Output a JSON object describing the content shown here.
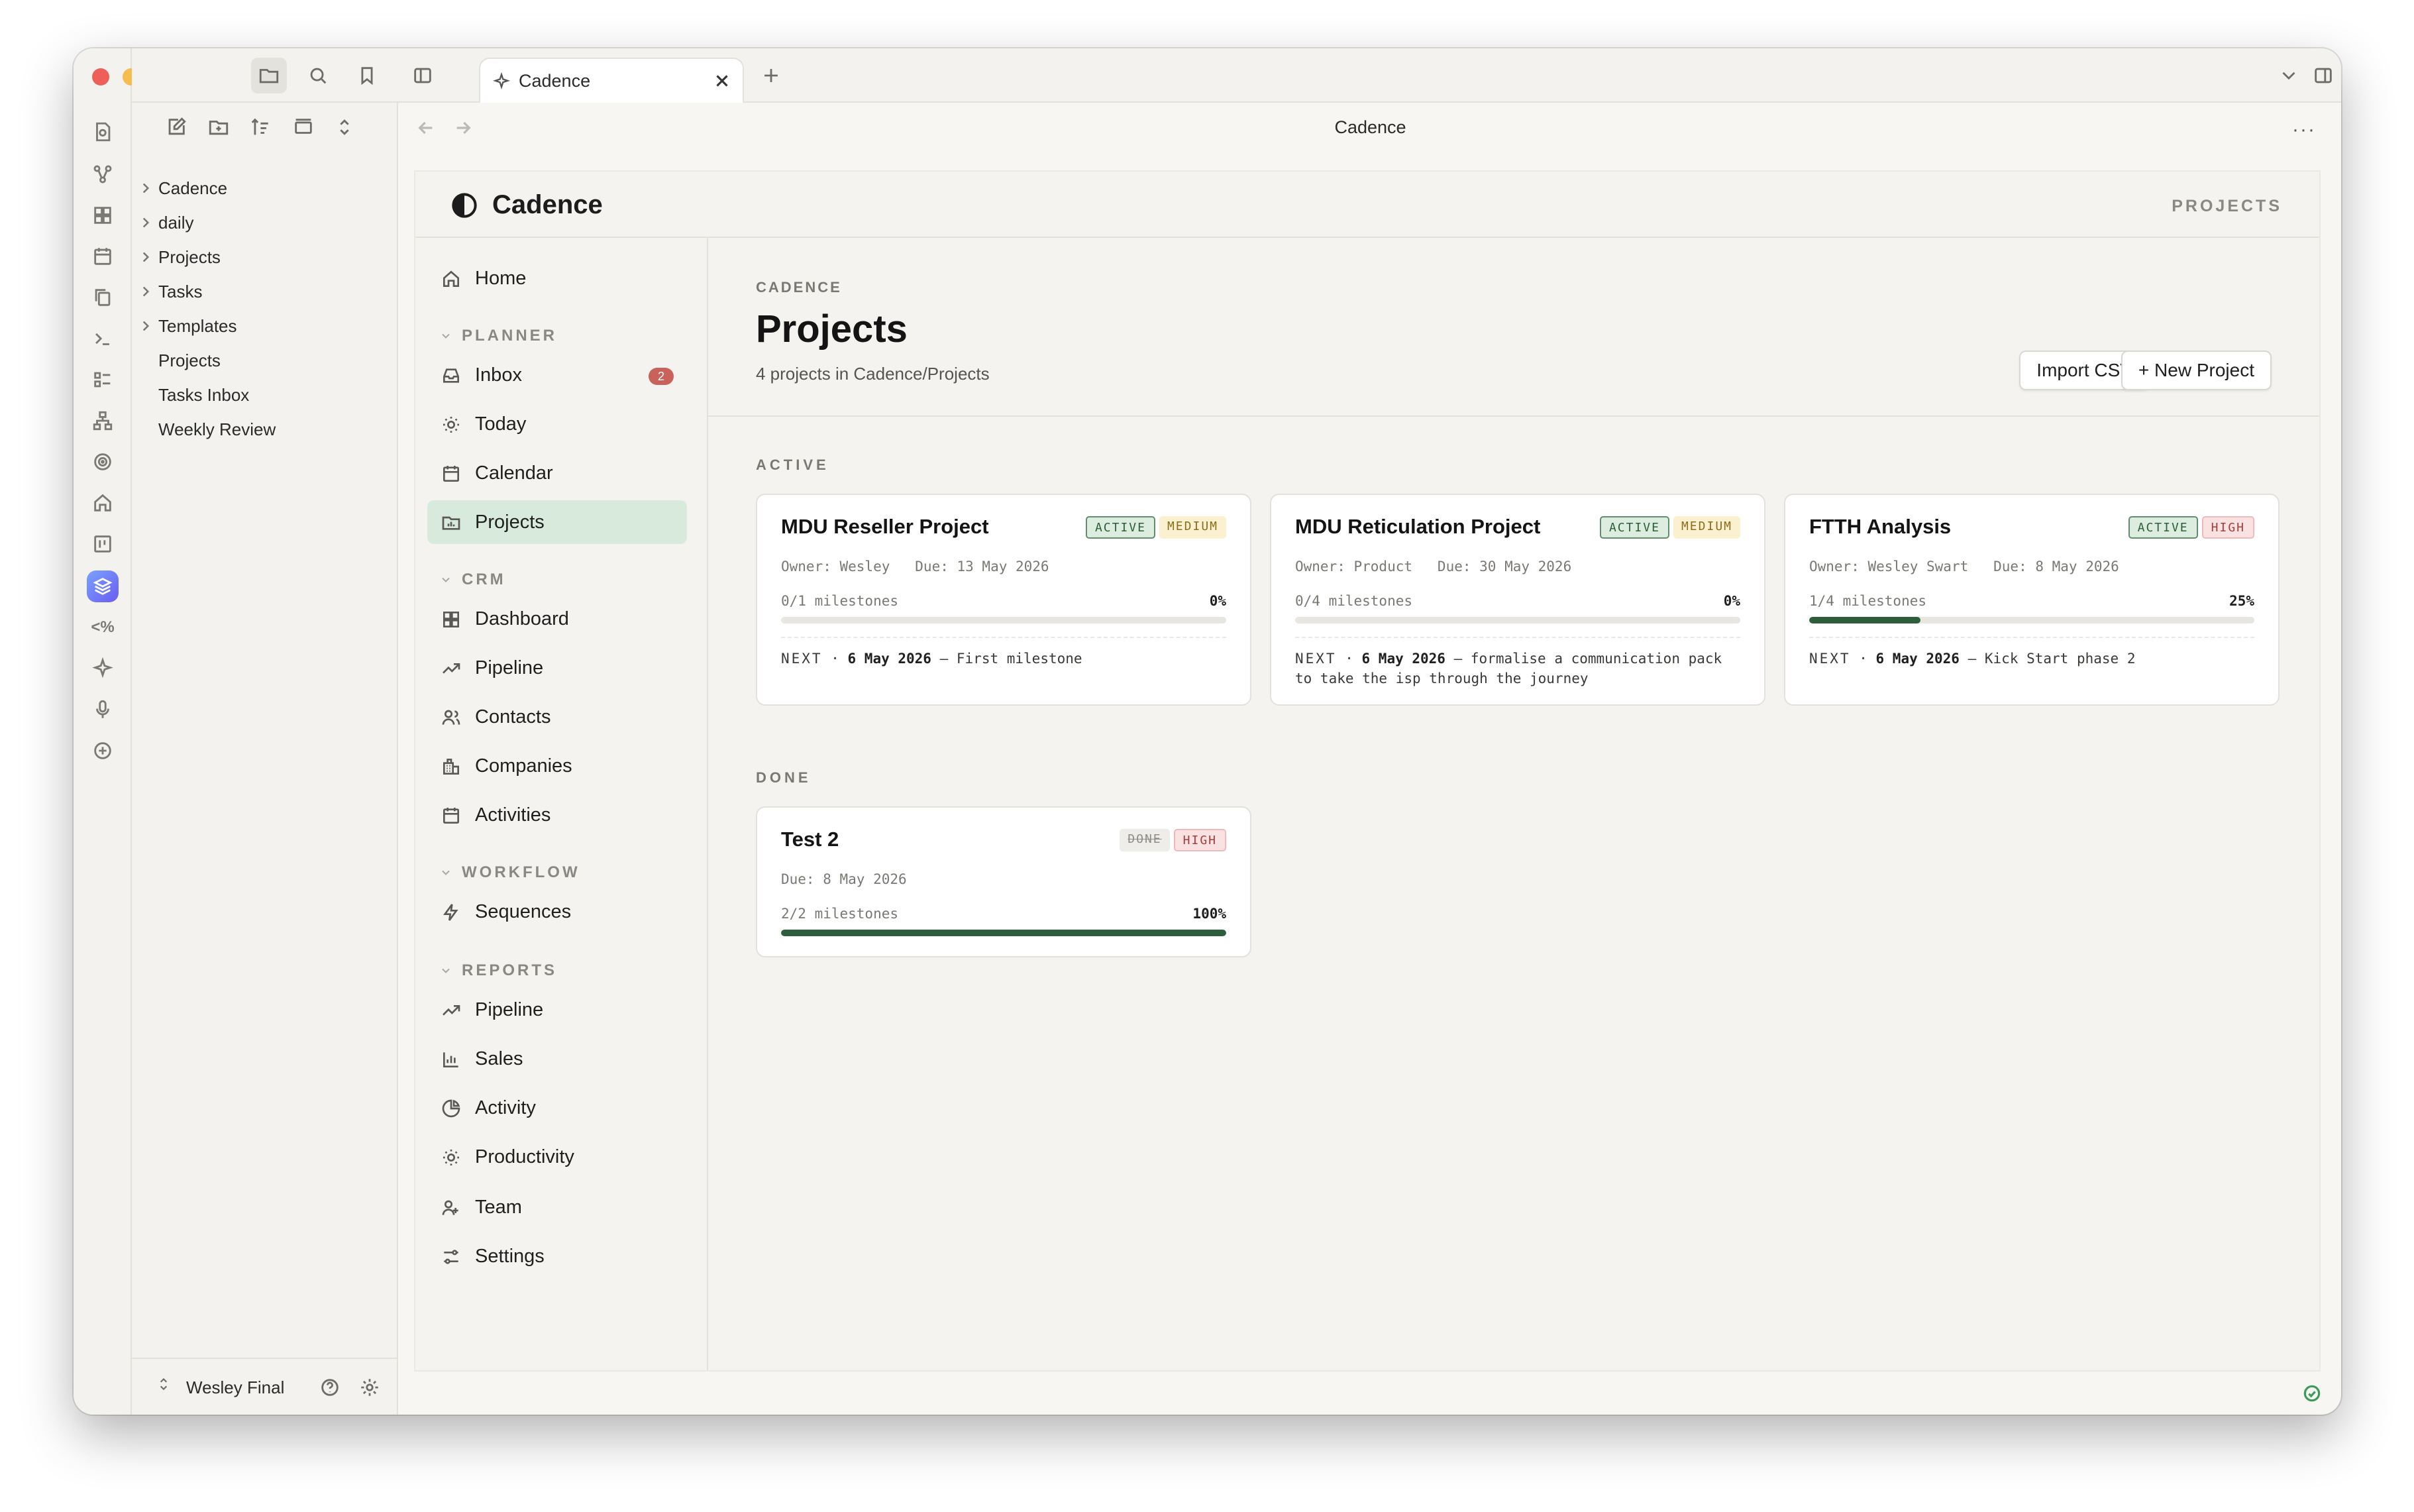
{
  "window": {
    "tab_title": "Cadence",
    "pane_title": "Cadence"
  },
  "explorer": {
    "items": [
      {
        "label": "Cadence",
        "folder": true
      },
      {
        "label": "daily",
        "folder": true
      },
      {
        "label": "Projects",
        "folder": true
      },
      {
        "label": "Tasks",
        "folder": true
      },
      {
        "label": "Templates",
        "folder": true
      },
      {
        "label": "Projects",
        "folder": false
      },
      {
        "label": "Tasks Inbox",
        "folder": false
      },
      {
        "label": "Weekly Review",
        "folder": false
      }
    ],
    "vault_name": "Wesley Final"
  },
  "app": {
    "brand": "Cadence",
    "header_crumb": "PROJECTS",
    "nav": {
      "home": "Home",
      "planner_section": "PLANNER",
      "inbox": "Inbox",
      "inbox_badge": "2",
      "today": "Today",
      "calendar": "Calendar",
      "projects": "Projects",
      "crm_section": "CRM",
      "dashboard": "Dashboard",
      "pipeline": "Pipeline",
      "contacts": "Contacts",
      "companies": "Companies",
      "activities": "Activities",
      "workflow_section": "WORKFLOW",
      "sequences": "Sequences",
      "reports_section": "REPORTS",
      "report_pipeline": "Pipeline",
      "sales": "Sales",
      "activity": "Activity",
      "productivity": "Productivity",
      "team": "Team",
      "settings": "Settings"
    },
    "page": {
      "eyebrow": "CADENCE",
      "title": "Projects",
      "subtitle": "4 projects in Cadence/Projects",
      "import_label": "Import CSV",
      "new_label": "+ New Project",
      "active_section": "ACTIVE",
      "done_section": "DONE"
    },
    "projects_active": [
      {
        "title": "MDU Reseller Project",
        "status": "ACTIVE",
        "priority": "MEDIUM",
        "meta": "Owner: Wesley   Due: 13 May 2026",
        "milestones": "0/1 milestones",
        "percent": "0%",
        "progress": 0,
        "next_label": "NEXT",
        "next_date": "6 May 2026",
        "next_text": "— First milestone"
      },
      {
        "title": "MDU Reticulation Project",
        "status": "ACTIVE",
        "priority": "MEDIUM",
        "meta": "Owner: Product   Due: 30 May 2026",
        "milestones": "0/4 milestones",
        "percent": "0%",
        "progress": 0,
        "next_label": "NEXT",
        "next_date": "6 May 2026",
        "next_text": "— formalise a communication pack to take the isp through the journey"
      },
      {
        "title": "FTTH Analysis",
        "status": "ACTIVE",
        "priority": "HIGH",
        "meta": "Owner: Wesley Swart   Due: 8 May 2026",
        "milestones": "1/4 milestones",
        "percent": "25%",
        "progress": 25,
        "next_label": "NEXT",
        "next_date": "6 May 2026",
        "next_text": "— Kick Start phase 2"
      }
    ],
    "projects_done": [
      {
        "title": "Test 2",
        "status": "DONE",
        "priority": "HIGH",
        "meta": "Due: 8 May 2026",
        "milestones": "2/2 milestones",
        "percent": "100%",
        "progress": 100
      }
    ]
  },
  "colors": {
    "accent_green": "#2e5e3b",
    "selected_nav": "#d8eadb",
    "badge_red": "#c9625a"
  }
}
